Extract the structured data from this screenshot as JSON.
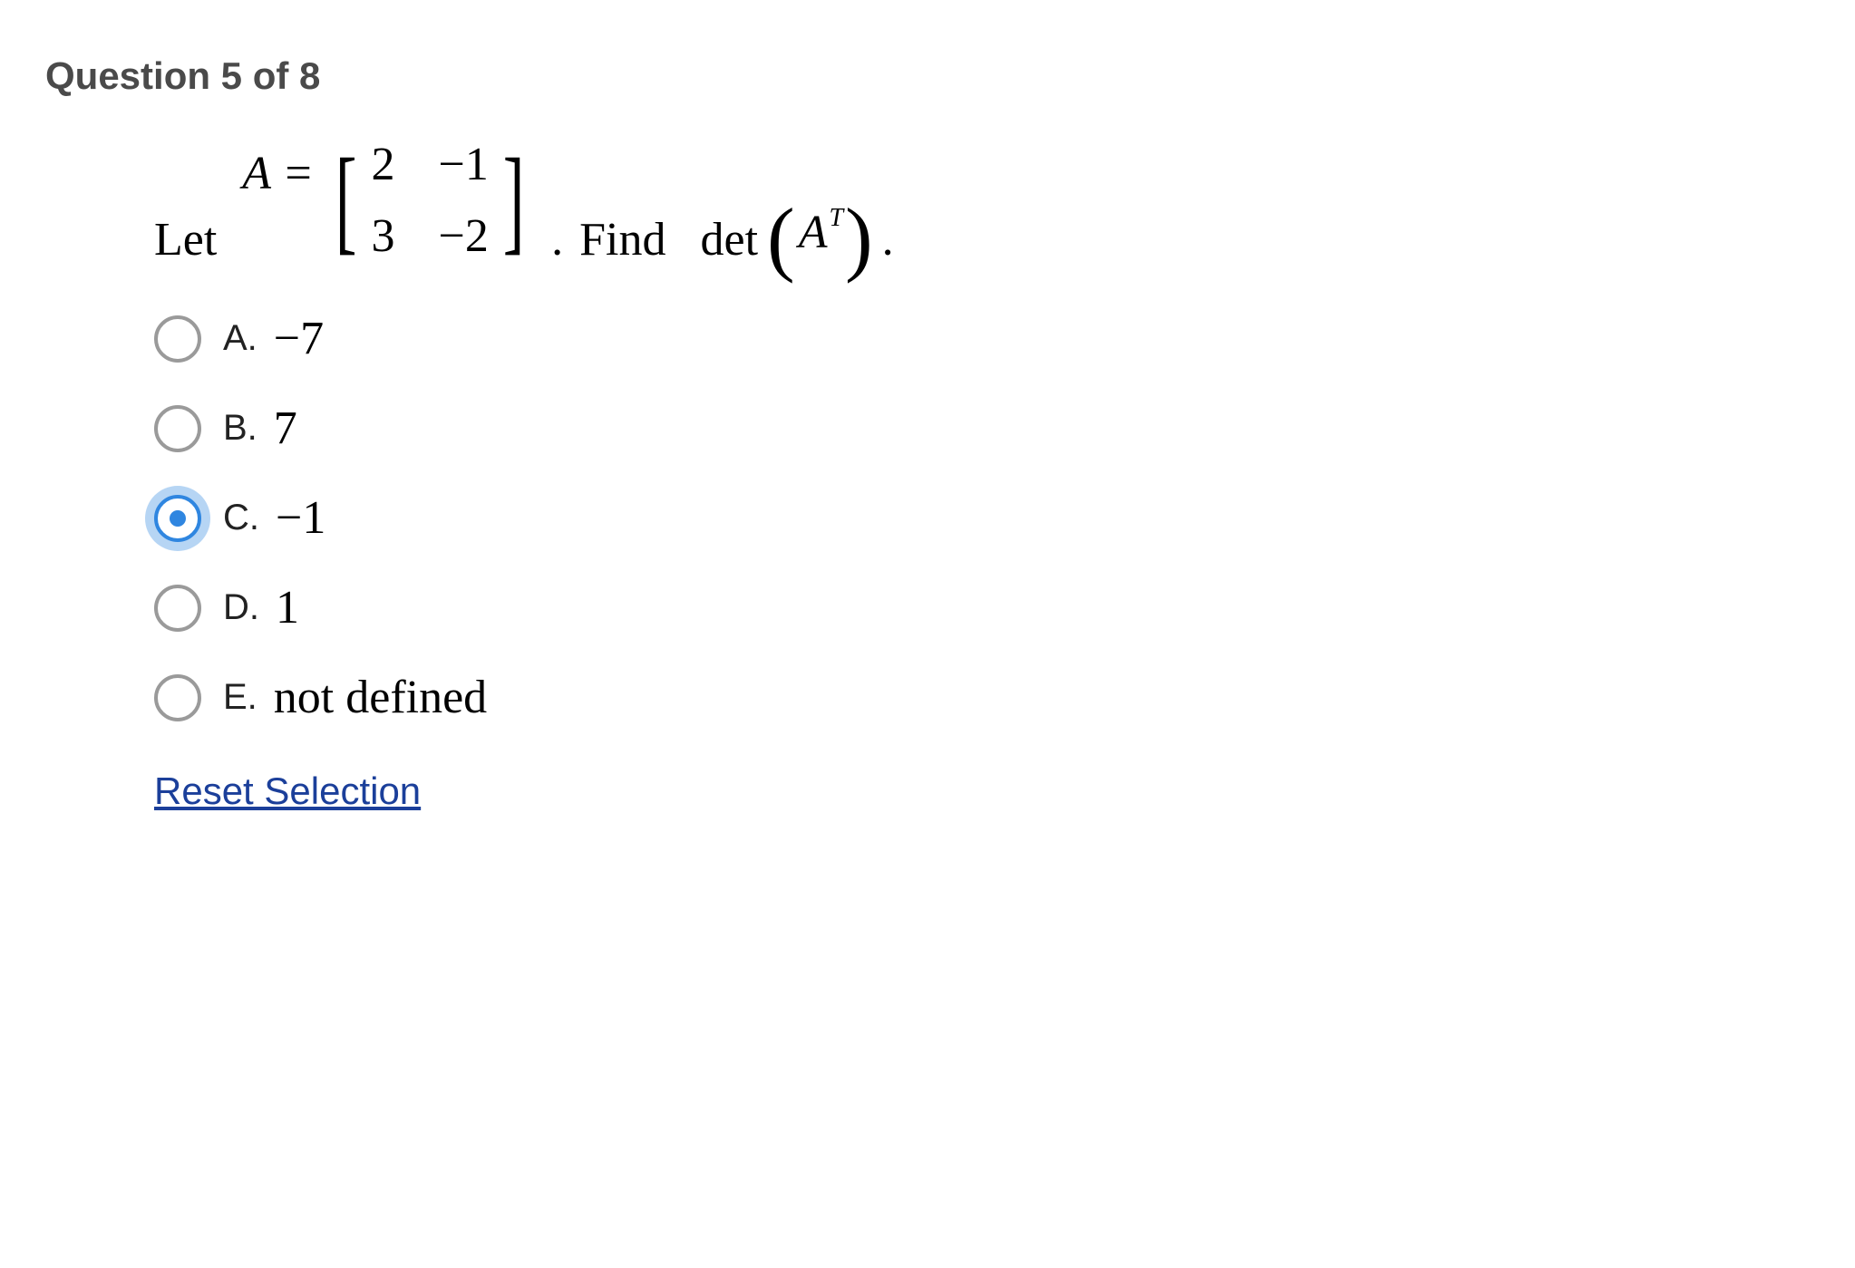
{
  "header": "Question 5 of 8",
  "stem": {
    "let": "Let",
    "a_eq": "A =",
    "matrix": {
      "r1c1": "2",
      "r1c2": "−1",
      "r2c1": "3",
      "r2c2": "−2"
    },
    "period1": ".",
    "find": "Find",
    "det": "det",
    "at_base": "A",
    "at_sup": "T",
    "period2": "."
  },
  "choices": [
    {
      "letter": "A.",
      "value": "−7",
      "selected": false
    },
    {
      "letter": "B.",
      "value": "7",
      "selected": false
    },
    {
      "letter": "C.",
      "value": "−1",
      "selected": true
    },
    {
      "letter": "D.",
      "value": "1",
      "selected": false
    },
    {
      "letter": "E.",
      "value": "not defined",
      "selected": false
    }
  ],
  "reset_label": "Reset Selection"
}
